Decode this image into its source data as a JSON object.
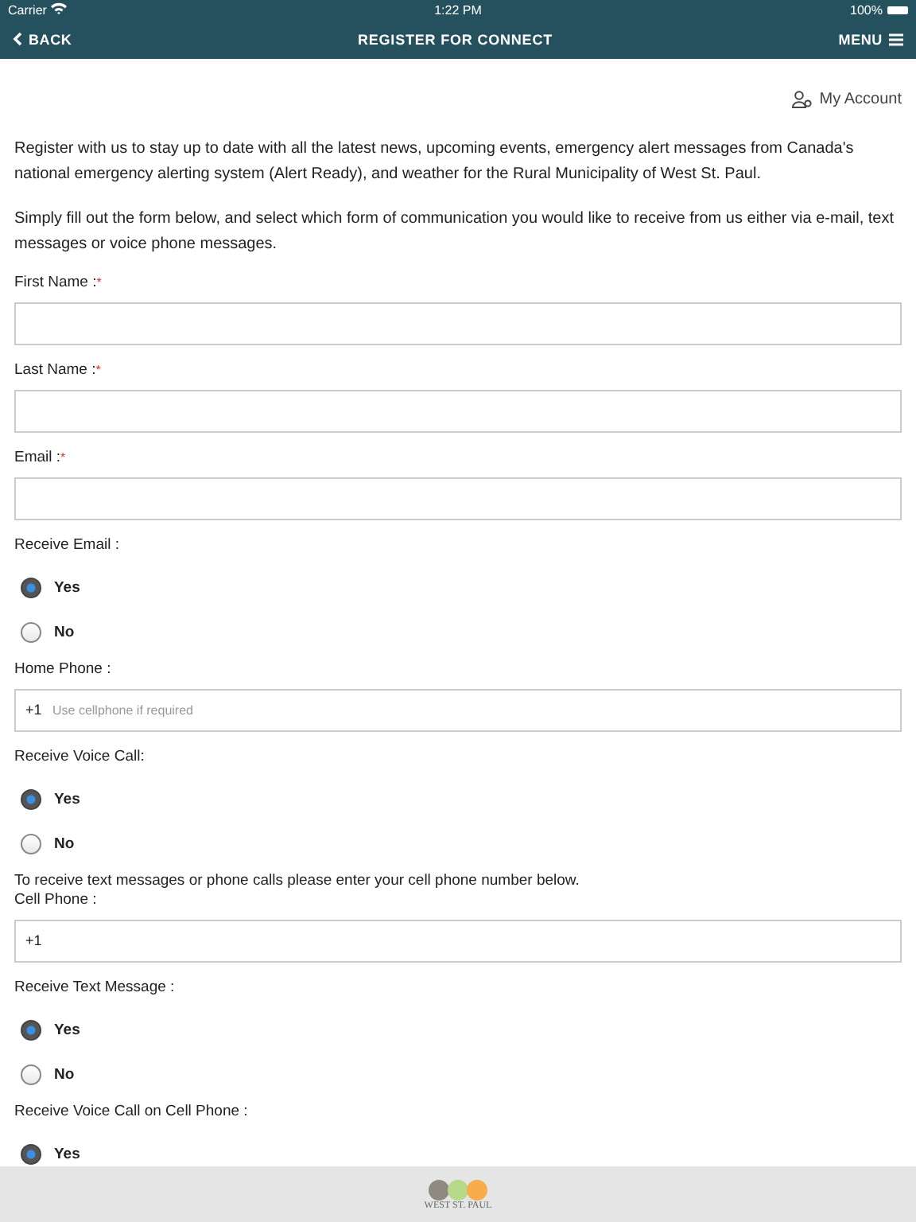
{
  "status_bar": {
    "carrier": "Carrier",
    "time": "1:22 PM",
    "battery": "100%"
  },
  "nav": {
    "back": "BACK",
    "title": "REGISTER FOR CONNECT",
    "menu": "MENU"
  },
  "account_link": "My Account",
  "intro": [
    "Register with us to stay up to date with all the latest news, upcoming events, emergency alert messages from Canada's national emergency alerting system (Alert Ready), and weather for the Rural Municipality of West St. Paul.",
    "Simply fill out the form below, and select which form of communication you would like to receive from us either via e-mail, text messages or voice phone messages."
  ],
  "form": [
    {
      "kind": "field",
      "label": "First Name :",
      "required_mark": "*"
    },
    {
      "kind": "field",
      "label": "Last Name :",
      "required_mark": "*"
    },
    {
      "kind": "field",
      "label": "Email :",
      "required_mark": "*"
    },
    {
      "kind": "radio",
      "label": "Receive Email :",
      "options": [
        {
          "label": "Yes",
          "selected": true
        },
        {
          "label": "No",
          "selected": false
        }
      ]
    },
    {
      "kind": "field",
      "label": "Home Phone :",
      "prefix": "+1",
      "placeholder": "Use cellphone if required"
    },
    {
      "kind": "radio",
      "label": "Receive Voice Call:",
      "options": [
        {
          "label": "Yes",
          "selected": true
        },
        {
          "label": "No",
          "selected": false
        }
      ]
    },
    {
      "kind": "note",
      "text": "To receive text messages or phone calls please enter your cell phone number below."
    },
    {
      "kind": "field",
      "label": "Cell Phone :",
      "prefix": "+1"
    },
    {
      "kind": "radio",
      "label": "Receive Text Message :",
      "options": [
        {
          "label": "Yes",
          "selected": true
        },
        {
          "label": "No",
          "selected": false
        }
      ]
    },
    {
      "kind": "radio",
      "label": "Receive Voice Call on Cell Phone :",
      "options": [
        {
          "label": "Yes",
          "selected": true
        }
      ]
    }
  ],
  "footer": {
    "logo_text": "WEST ST. PAUL"
  }
}
